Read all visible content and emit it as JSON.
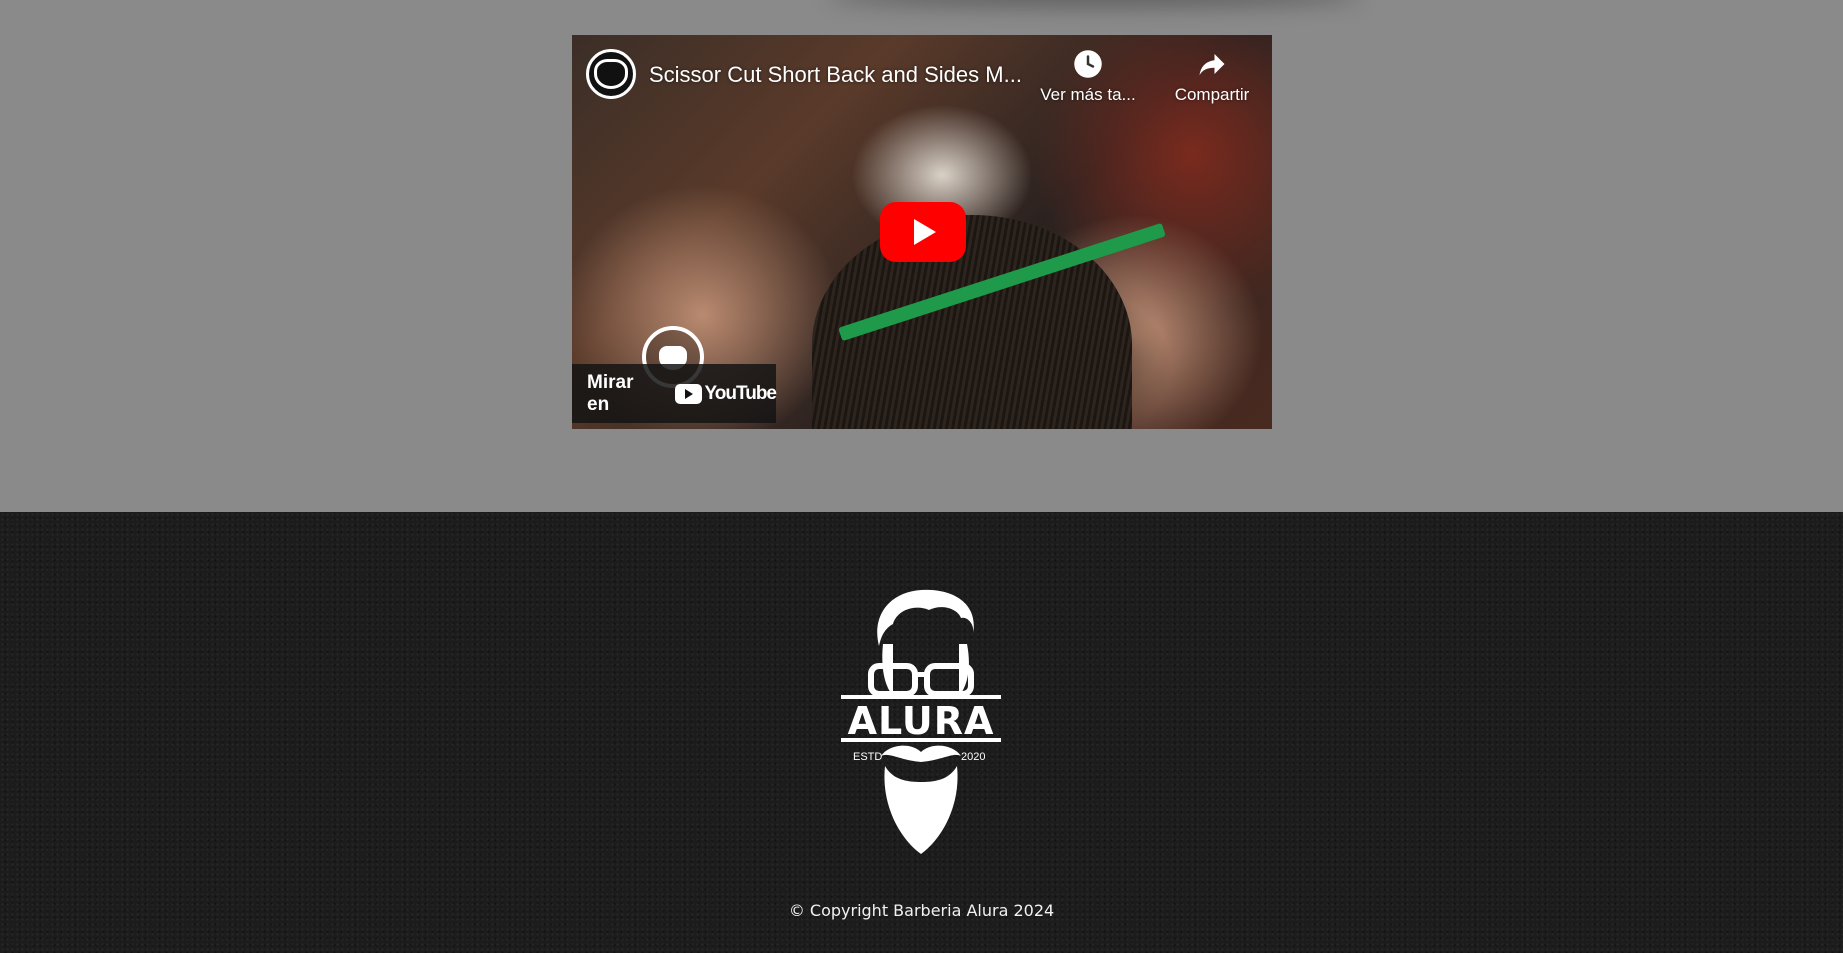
{
  "video": {
    "title": "Scissor Cut Short Back and Sides M...",
    "watch_later_label": "Ver más ta...",
    "share_label": "Compartir",
    "watch_on_label": "Mirar en",
    "youtube_label": "YouTube",
    "play_color": "#ff0000"
  },
  "footer": {
    "logo": {
      "brand": "ALURA",
      "estd": "ESTD",
      "year": "2020"
    },
    "copyright": "© Copyright Barberia Alura 2024",
    "background_color": "#1c1c1c"
  },
  "page": {
    "background_color": "#8a8a8a"
  }
}
